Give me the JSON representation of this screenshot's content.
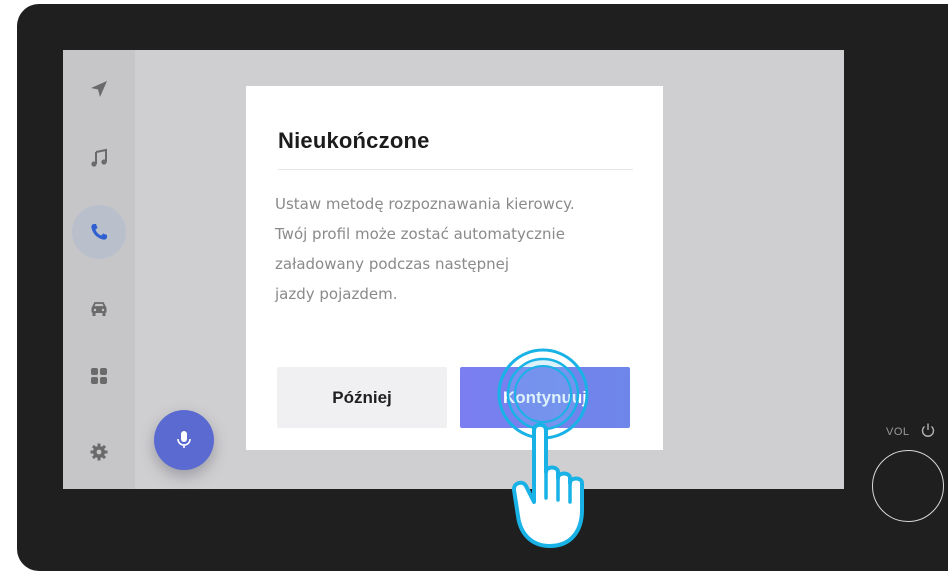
{
  "dialog": {
    "title": "Nieukończone",
    "body_lines": [
      "Ustaw metodę rozpoznawania kierowcy.",
      "Twój profil może zostać automatycznie",
      "załadowany podczas następnej",
      "jazdy pojazdem."
    ],
    "later_label": "Później",
    "continue_label": "Kontynuuj"
  },
  "sidebar": {
    "items": [
      {
        "icon": "navigation-icon",
        "active": false
      },
      {
        "icon": "music-icon",
        "active": false
      },
      {
        "icon": "phone-icon",
        "active": true
      },
      {
        "icon": "car-icon",
        "active": false
      },
      {
        "icon": "apps-grid-icon",
        "active": false
      },
      {
        "icon": "settings-gear-icon",
        "active": false
      }
    ]
  },
  "voice_button": {
    "icon": "microphone-icon"
  },
  "hardware": {
    "vol_label": "VOL",
    "power_icon": "power-icon"
  },
  "colors": {
    "accent": "#6e7ff0",
    "phone_active": "#2f5fd0",
    "mic_button": "#5b6ad0",
    "tap_ring": "#19b2e6"
  }
}
